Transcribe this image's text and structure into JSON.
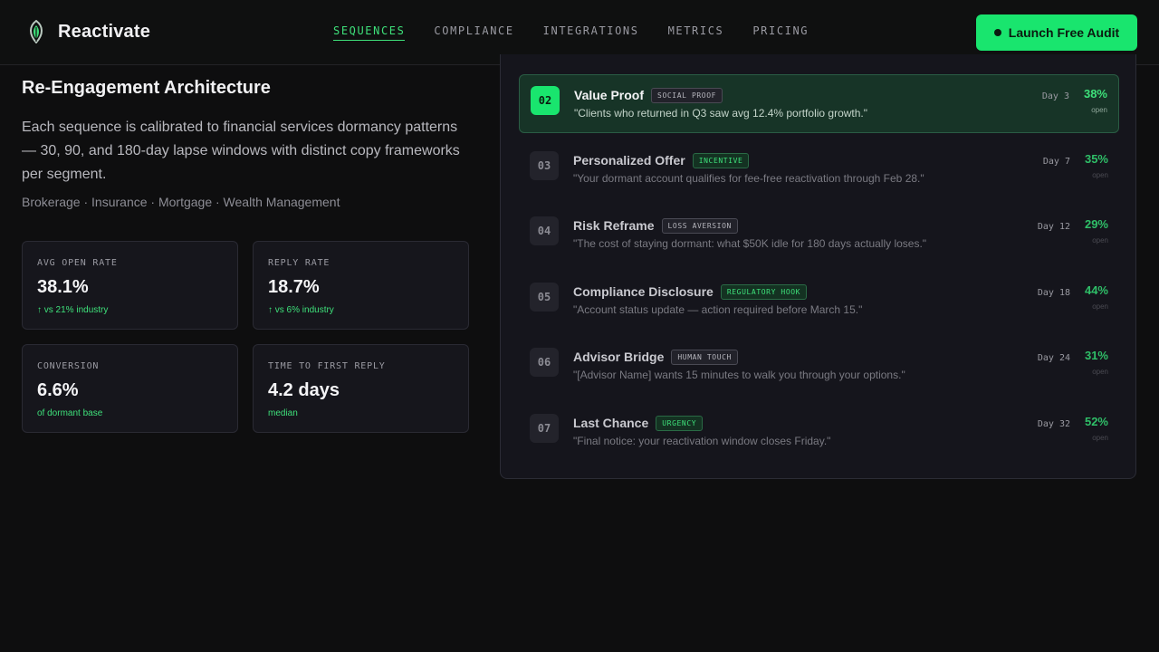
{
  "header": {
    "brand": "Reactivate",
    "nav": [
      "SEQUENCES",
      "COMPLIANCE",
      "INTEGRATIONS",
      "METRICS",
      "PRICING"
    ],
    "active_nav": "SEQUENCES",
    "cta_label": "Launch Free Audit"
  },
  "intro": {
    "title": "Re-Engagement Architecture",
    "description": "Each sequence is calibrated to financial services dormancy patterns — 30, 90, and 180-day lapse windows with distinct copy frameworks per segment.",
    "segments": "Brokerage · Insurance · Mortgage · Wealth Management"
  },
  "stats": [
    {
      "label": "AVG OPEN RATE",
      "value": "38.1%",
      "note": "↑ vs 21% industry"
    },
    {
      "label": "REPLY RATE",
      "value": "18.7%",
      "note": "↑ vs 6% industry"
    },
    {
      "label": "CONVERSION",
      "value": "6.6%",
      "note": "of dormant base"
    },
    {
      "label": "TIME TO FIRST REPLY",
      "value": "4.2 days",
      "note": "median"
    }
  ],
  "sequence": [
    {
      "num": "02",
      "name": "Value Proof",
      "tag": "SOCIAL PROOF",
      "tag_style": "grey",
      "quote": "\"Clients who returned in Q3 saw avg 12.4% portfolio growth.\"",
      "day": "Day 3",
      "pct": "38%",
      "open": "open"
    },
    {
      "num": "03",
      "name": "Personalized Offer",
      "tag": "INCENTIVE",
      "tag_style": "green",
      "quote": "\"Your dormant account qualifies for fee-free reactivation through Feb 28.\"",
      "day": "Day 7",
      "pct": "35%",
      "open": "open"
    },
    {
      "num": "04",
      "name": "Risk Reframe",
      "tag": "LOSS AVERSION",
      "tag_style": "grey",
      "quote": "\"The cost of staying dormant: what $50K idle for 180 days actually loses.\"",
      "day": "Day 12",
      "pct": "29%",
      "open": "open"
    },
    {
      "num": "05",
      "name": "Compliance Disclosure",
      "tag": "REGULATORY HOOK",
      "tag_style": "green",
      "quote": "\"Account status update — action required before March 15.\"",
      "day": "Day 18",
      "pct": "44%",
      "open": "open"
    },
    {
      "num": "06",
      "name": "Advisor Bridge",
      "tag": "HUMAN TOUCH",
      "tag_style": "grey",
      "quote": "\"[Advisor Name] wants 15 minutes to walk you through your options.\"",
      "day": "Day 24",
      "pct": "31%",
      "open": "open"
    },
    {
      "num": "07",
      "name": "Last Chance",
      "tag": "URGENCY",
      "tag_style": "green",
      "quote": "\"Final notice: your reactivation window closes Friday.\"",
      "day": "Day 32",
      "pct": "52%",
      "open": "open"
    }
  ]
}
